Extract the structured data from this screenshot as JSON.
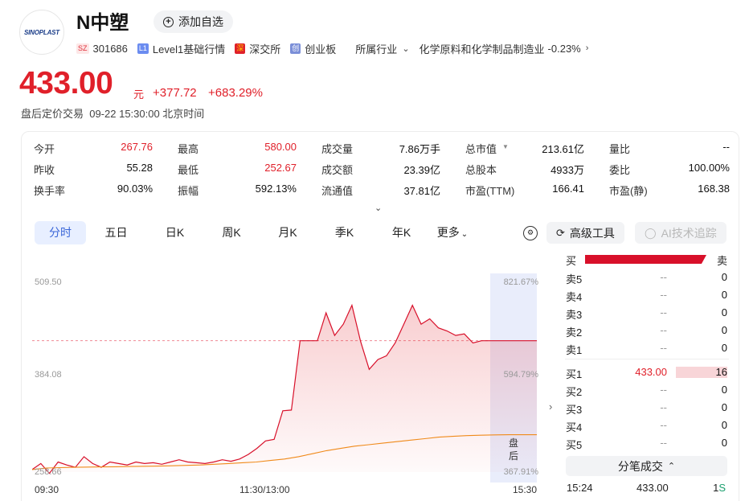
{
  "header": {
    "logo_text": "SINOPLAST",
    "name": "N中塑",
    "watchlist_btn": "添加自选",
    "exchange_tag": "SZ",
    "code": "301686",
    "level_tag": "L1",
    "level_text": "Level1基础行情",
    "market_tag": "深",
    "market_text": "深交所",
    "board_tag": "创",
    "board_text": "创业板",
    "industry_label": "所属行业",
    "industry_name": "化学原料和化学制品制造业",
    "industry_change": "-0.23%"
  },
  "quote": {
    "price": "433.00",
    "unit": "元",
    "change": "+377.72",
    "change_pct": "+683.29%",
    "status": "盘后定价交易  09-22 15:30:00 北京时间"
  },
  "stats": [
    [
      {
        "k": "今开",
        "v": "267.76",
        "red": true
      },
      {
        "k": "最高",
        "v": "580.00",
        "red": true
      },
      {
        "k": "成交量",
        "v": "7.86万手"
      },
      {
        "k": "总市值",
        "v": "213.61亿",
        "dropdown": true
      },
      {
        "k": "量比",
        "v": "--"
      }
    ],
    [
      {
        "k": "昨收",
        "v": "55.28"
      },
      {
        "k": "最低",
        "v": "252.67",
        "red": true
      },
      {
        "k": "成交额",
        "v": "23.39亿"
      },
      {
        "k": "总股本",
        "v": "4933万"
      },
      {
        "k": "委比",
        "v": "100.00%"
      }
    ],
    [
      {
        "k": "换手率",
        "v": "90.03%"
      },
      {
        "k": "振幅",
        "v": "592.13%"
      },
      {
        "k": "流通值",
        "v": "37.81亿"
      },
      {
        "k": "市盈(TTM)",
        "v": "166.41"
      },
      {
        "k": "市盈(静)",
        "v": "168.38"
      }
    ]
  ],
  "tabs": [
    "分时",
    "五日",
    "日K",
    "周K",
    "月K",
    "季K",
    "年K",
    "更多"
  ],
  "active_tab": 0,
  "tools": {
    "advanced": "高级工具",
    "ai": "AI技术追踪"
  },
  "chart_labels": {
    "y_top": "509.50",
    "y_mid": "384.08",
    "y_bottom": "258.66",
    "pct_top": "821.67%",
    "pct_mid": "594.79%",
    "pct_bottom": "367.91%",
    "x_start": "09:30",
    "x_mid": "11:30/13:00",
    "x_end": "15:30",
    "after_hours_1": "盘",
    "after_hours_2": "后"
  },
  "chart_data": {
    "type": "line",
    "title": "",
    "xlabel": "",
    "ylabel": "",
    "ylim": [
      258.66,
      509.5
    ],
    "x_ticks": [
      "09:30",
      "11:30/13:00",
      "15:30"
    ],
    "reference_price": 433.0,
    "series": [
      {
        "values": [
          262,
          270,
          257,
          272,
          268,
          265,
          279,
          270,
          265,
          272,
          270,
          268,
          272,
          270,
          271,
          269,
          272,
          275,
          272,
          271,
          270,
          272,
          275,
          273,
          276,
          282,
          290,
          300,
          302,
          340,
          341,
          433,
          433,
          433,
          470,
          440,
          455,
          480,
          432,
          395,
          408,
          413,
          430,
          455,
          480,
          455,
          462,
          450,
          446,
          440,
          442,
          430,
          433,
          433,
          433,
          433,
          433
        ]
      },
      {
        "values": [
          262,
          264,
          264.5,
          265,
          265.3,
          265.5,
          265.7,
          266,
          266.3,
          266.6,
          267,
          267.5,
          268,
          269,
          270,
          271,
          272,
          274,
          276,
          279,
          283,
          287,
          290,
          293,
          295,
          297,
          299,
          301,
          303,
          305,
          306,
          307,
          307.5,
          308,
          308.2,
          308.2,
          308.2
        ]
      }
    ]
  },
  "orderbook": {
    "buy_label": "买",
    "sell_label": "卖",
    "asks": [
      {
        "label": "卖5",
        "price": "--",
        "qty": "0"
      },
      {
        "label": "卖4",
        "price": "--",
        "qty": "0"
      },
      {
        "label": "卖3",
        "price": "--",
        "qty": "0"
      },
      {
        "label": "卖2",
        "price": "--",
        "qty": "0"
      },
      {
        "label": "卖1",
        "price": "--",
        "qty": "0"
      }
    ],
    "bids": [
      {
        "label": "买1",
        "price": "433.00",
        "qty": "16"
      },
      {
        "label": "买2",
        "price": "--",
        "qty": "0"
      },
      {
        "label": "买3",
        "price": "--",
        "qty": "0"
      },
      {
        "label": "买4",
        "price": "--",
        "qty": "0"
      },
      {
        "label": "买5",
        "price": "--",
        "qty": "0"
      }
    ],
    "trades_btn": "分笔成交",
    "trade": {
      "time": "15:24",
      "price": "433.00",
      "vol": "1",
      "flag": "S"
    }
  }
}
